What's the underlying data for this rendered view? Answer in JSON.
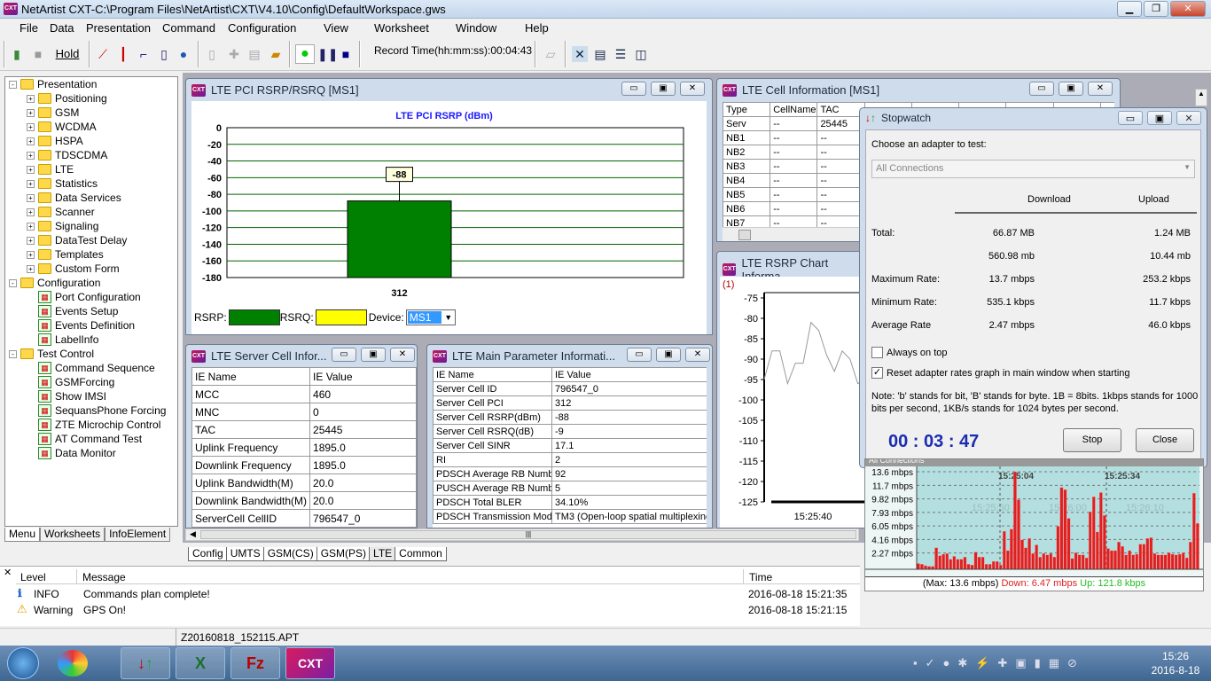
{
  "app": {
    "title": "NetArtist CXT-C:\\Program Files\\NetArtist\\CXT\\V4.10\\Config\\DefaultWorkspace.gws",
    "icon": "CXT"
  },
  "menu": [
    "File",
    "Data",
    "Presentation",
    "Command",
    "Configuration",
    "View",
    "Worksheet",
    "Window",
    "Help"
  ],
  "toolbar": {
    "hold": "Hold",
    "record_time": "Record Time(hh:mm:ss):00:04:43"
  },
  "tree": [
    {
      "label": "Presentation",
      "level": 0,
      "type": "folder",
      "exp": "-"
    },
    {
      "label": "Positioning",
      "level": 1,
      "type": "folder",
      "exp": "+"
    },
    {
      "label": "GSM",
      "level": 1,
      "type": "folder",
      "exp": "+"
    },
    {
      "label": "WCDMA",
      "level": 1,
      "type": "folder",
      "exp": "+"
    },
    {
      "label": "HSPA",
      "level": 1,
      "type": "folder",
      "exp": "+"
    },
    {
      "label": "TDSCDMA",
      "level": 1,
      "type": "folder",
      "exp": "+"
    },
    {
      "label": "LTE",
      "level": 1,
      "type": "folder",
      "exp": "+"
    },
    {
      "label": "Statistics",
      "level": 1,
      "type": "folder",
      "exp": "+"
    },
    {
      "label": "Data Services",
      "level": 1,
      "type": "folder",
      "exp": "+"
    },
    {
      "label": "Scanner",
      "level": 1,
      "type": "folder",
      "exp": "+"
    },
    {
      "label": "Signaling",
      "level": 1,
      "type": "folder",
      "exp": "+"
    },
    {
      "label": "DataTest Delay",
      "level": 1,
      "type": "folder",
      "exp": "+"
    },
    {
      "label": "Templates",
      "level": 1,
      "type": "folder",
      "exp": "+"
    },
    {
      "label": "Custom Form",
      "level": 1,
      "type": "folder",
      "exp": "+"
    },
    {
      "label": "Configuration",
      "level": 0,
      "type": "folder",
      "exp": "-"
    },
    {
      "label": "Port Configuration",
      "level": 1,
      "type": "leaf"
    },
    {
      "label": "Events Setup",
      "level": 1,
      "type": "leaf"
    },
    {
      "label": "Events Definition",
      "level": 1,
      "type": "leaf"
    },
    {
      "label": "LabelInfo",
      "level": 1,
      "type": "leaf"
    },
    {
      "label": "Test Control",
      "level": 0,
      "type": "folder",
      "exp": "-"
    },
    {
      "label": "Command Sequence",
      "level": 1,
      "type": "leaf"
    },
    {
      "label": "GSMForcing",
      "level": 1,
      "type": "leaf"
    },
    {
      "label": "Show IMSI",
      "level": 1,
      "type": "leaf"
    },
    {
      "label": "SequansPhone Forcing",
      "level": 1,
      "type": "leaf"
    },
    {
      "label": "ZTE Microchip Control",
      "level": 1,
      "type": "leaf"
    },
    {
      "label": "AT Command Test",
      "level": 1,
      "type": "leaf"
    },
    {
      "label": "Data Monitor",
      "level": 1,
      "type": "leaf"
    }
  ],
  "left_tabs": [
    "Menu",
    "Worksheets",
    "InfoElement"
  ],
  "rsrp_window": {
    "title": "LTE PCI RSRP/RSRQ [MS1]",
    "chart_title": "LTE PCI RSRP (dBm)",
    "y_ticks": [
      "0",
      "-20",
      "-40",
      "-60",
      "-80",
      "-100",
      "-120",
      "-140",
      "-160",
      "-180"
    ],
    "ylim": [
      -180,
      0
    ],
    "bar": {
      "category": "312",
      "value": -88,
      "label": "-88",
      "color": "#008000"
    },
    "legend": {
      "rsrp_label": "RSRP:",
      "rsrp_color": "#008000",
      "rsrq_label": "RSRQ:",
      "rsrq_color": "#ffff00",
      "device_label": "Device:",
      "device_value": "MS1"
    }
  },
  "server_cell": {
    "title": "LTE Server Cell Infor...",
    "headers": [
      "IE Name",
      "IE Value"
    ],
    "rows": [
      [
        "MCC",
        "460"
      ],
      [
        "MNC",
        "0"
      ],
      [
        "TAC",
        "25445"
      ],
      [
        "Uplink Frequency",
        "1895.0"
      ],
      [
        "Downlink Frequency",
        "1895.0"
      ],
      [
        "Uplink Bandwidth(M)",
        "20.0"
      ],
      [
        "Downlink Bandwidth(M)",
        "20.0"
      ],
      [
        "ServerCell CellID",
        "796547_0"
      ]
    ]
  },
  "main_param": {
    "title": "LTE Main Parameter Informati...",
    "headers": [
      "IE Name",
      "IE Value"
    ],
    "rows": [
      [
        "Server Cell ID",
        "796547_0"
      ],
      [
        "Server Cell PCI",
        "312"
      ],
      [
        "Server Cell RSRP(dBm)",
        "-88"
      ],
      [
        "Server Cell RSRQ(dB)",
        "-9"
      ],
      [
        "Server Cell SINR",
        "17.1"
      ],
      [
        "RI",
        "2"
      ],
      [
        "PDSCH Average RB Numbe",
        "92"
      ],
      [
        "PUSCH Average RB Numbe",
        "5"
      ],
      [
        "PDSCH Total BLER",
        "34.10%"
      ],
      [
        "PDSCH Transmission Mode",
        "TM3 (Open-loop spatial multiplexing"
      ]
    ]
  },
  "cell_info": {
    "title": "LTE Cell Information [MS1]",
    "headers": [
      "Type",
      "CellName",
      "TAC"
    ],
    "rows": [
      [
        "Serv",
        "--",
        "25445"
      ],
      [
        "NB1",
        "--",
        "--"
      ],
      [
        "NB2",
        "--",
        "--"
      ],
      [
        "NB3",
        "--",
        "--"
      ],
      [
        "NB4",
        "--",
        "--"
      ],
      [
        "NB5",
        "--",
        "--"
      ],
      [
        "NB6",
        "--",
        "--"
      ],
      [
        "NB7",
        "--",
        "--"
      ]
    ]
  },
  "rsrp_chart": {
    "title": "LTE RSRP Chart Informa",
    "series_label": "(1)",
    "y_ticks": [
      "-75",
      "-80",
      "-85",
      "-90",
      "-95",
      "-100",
      "-105",
      "-110",
      "-115",
      "-120",
      "-125"
    ],
    "ylim": [
      -125,
      -75
    ],
    "x_tick": "15:25:40",
    "values": [
      -95,
      -88,
      -88,
      -96,
      -91,
      -91,
      -81,
      -83,
      -89,
      -93,
      -88,
      -90,
      -96,
      -95
    ]
  },
  "stopwatch": {
    "title": "Stopwatch",
    "choose_label": "Choose an adapter to test:",
    "adapter": "All Connections",
    "col_download": "Download",
    "col_upload": "Upload",
    "rows": [
      {
        "label": "Total:",
        "download": "66.87 MB",
        "upload": "1.24 MB"
      },
      {
        "label": "",
        "download": "560.98 mb",
        "upload": "10.44 mb"
      },
      {
        "label": "Maximum Rate:",
        "download": "13.7 mbps",
        "upload": "253.2 kbps"
      },
      {
        "label": "Minimum Rate:",
        "download": "535.1 kbps",
        "upload": "11.7 kbps"
      },
      {
        "label": "Average Rate",
        "download": "2.47 mbps",
        "upload": "46.0 kbps"
      }
    ],
    "always_on_top": {
      "label": "Always on top",
      "checked": false
    },
    "reset_graph": {
      "label": "Reset adapter rates graph in main window when starting",
      "checked": true
    },
    "note": "Note: 'b' stands for bit, 'B' stands for byte. 1B = 8bits. 1kbps stands for 1000 bits per second, 1KB/s stands for 1024 bytes per second.",
    "timer": "00 : 03 : 47",
    "stop": "Stop",
    "close": "Close"
  },
  "netgraph": {
    "title": "All Connections",
    "y_ticks": [
      "13.6 mbps",
      "11.7 mbps",
      "9.82 mbps",
      "7.93 mbps",
      "6.05 mbps",
      "4.16 mbps",
      "2.27 mbps"
    ],
    "y_max_mbps": 13.6,
    "time_labels": [
      "15:25:04",
      "15:25:34"
    ],
    "ghost_labels": [
      "15:25:50",
      "15:26:00",
      "15:26:10",
      "15:26:20"
    ],
    "download_mbps": [
      0.8,
      0.7,
      0.5,
      0.4,
      0.4,
      3.0,
      1.9,
      2.1,
      2.2,
      1.4,
      1.8,
      1.4,
      1.4,
      1.7,
      0.7,
      0.6,
      2.4,
      1.7,
      1.7,
      0.7,
      0.7,
      1.1,
      1.1,
      0.6,
      5.3,
      2.6,
      5.6,
      13.6,
      9.7,
      4.1,
      3.0,
      4.3,
      2.2,
      3.4,
      1.7,
      2.2,
      2.0,
      2.2,
      1.7,
      6.0,
      11.4,
      11.1,
      7.1,
      1.5,
      2.3,
      2.0,
      2.0,
      1.6,
      8.0,
      10.1,
      5.2,
      10.7,
      7.5,
      2.9,
      2.6,
      2.6,
      3.8,
      3.2,
      2.0,
      2.6,
      2.0,
      2.1,
      3.5,
      3.5,
      4.3,
      4.4,
      2.2,
      2.0,
      2.0,
      2.0,
      2.3,
      2.1,
      2.0,
      2.1,
      2.3,
      1.6,
      3.8,
      10.6,
      6.4
    ],
    "max_text": "(Max: 13.6 mbps)",
    "down_text": "Down: 6.47 mbps",
    "up_text": "Up: 121.8 kbps",
    "colors": {
      "down": "#e02020",
      "up": "#20c020",
      "bg": "#b3dfe0"
    }
  },
  "sheet_tabs": [
    "Config",
    "UMTS",
    "GSM(CS)",
    "GSM(PS)",
    "LTE",
    "Common"
  ],
  "log": {
    "headers": [
      "Level",
      "Message",
      "Time"
    ],
    "rows": [
      {
        "level": "INFO",
        "message": "Commands plan complete!",
        "time": "2016-08-18 15:21:35",
        "icon": "info-icon"
      },
      {
        "level": "Warning",
        "message": "GPS On!",
        "time": "2016-08-18 15:21:15",
        "icon": "warning-icon"
      }
    ]
  },
  "status": {
    "file": "Z20160818_152115.APT"
  },
  "taskbar": {
    "time": "15:26",
    "date": "2016-8-18",
    "apps": [
      "start",
      "photos",
      "transfer",
      "excel",
      "filezilla",
      "cxt"
    ]
  }
}
